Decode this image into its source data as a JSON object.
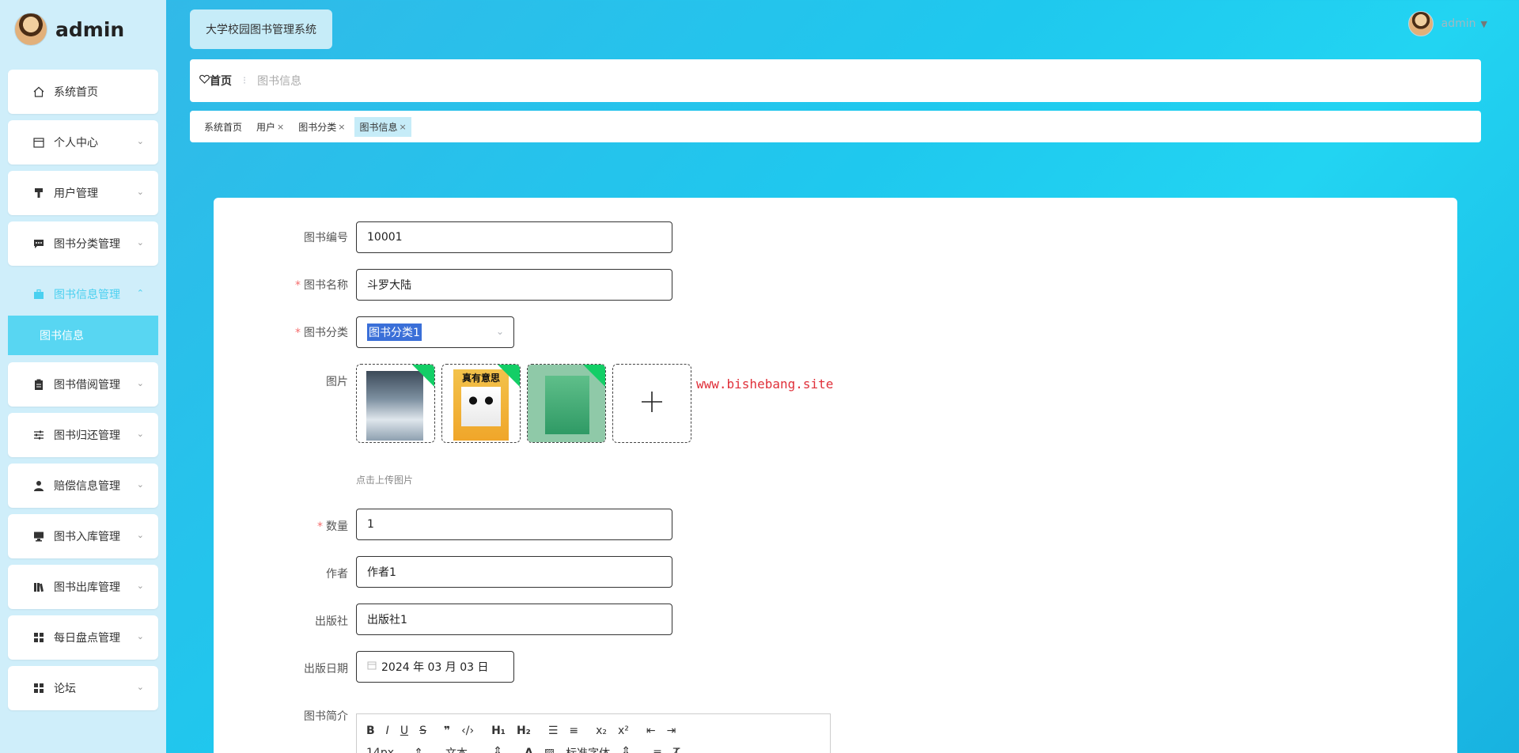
{
  "sidebar": {
    "brand": "admin",
    "items": [
      {
        "label": "系统首页"
      },
      {
        "label": "个人中心"
      },
      {
        "label": "用户管理"
      },
      {
        "label": "图书分类管理"
      },
      {
        "label": "图书信息管理"
      },
      {
        "label": "图书借阅管理"
      },
      {
        "label": "图书归还管理"
      },
      {
        "label": "赔偿信息管理"
      },
      {
        "label": "图书入库管理"
      },
      {
        "label": "图书出库管理"
      },
      {
        "label": "每日盘点管理"
      },
      {
        "label": "论坛"
      }
    ],
    "sub_item": "图书信息"
  },
  "header": {
    "app_title": "大学校园图书管理系统",
    "user_name": "admin"
  },
  "breadcrumb": {
    "home": "首页",
    "current": "图书信息"
  },
  "tabs": [
    {
      "label": "系统首页"
    },
    {
      "label": "用户"
    },
    {
      "label": "图书分类"
    },
    {
      "label": "图书信息"
    }
  ],
  "form": {
    "book_no_label": "图书编号",
    "book_no": "10001",
    "book_name_label": "图书名称",
    "book_name": "斗罗大陆",
    "category_label": "图书分类",
    "category": "图书分类1",
    "image_label": "图片",
    "cover2_text": "真有意思",
    "upload_hint": "点击上传图片",
    "watermark": "www.bishebang.site",
    "quantity_label": "数量",
    "quantity": "1",
    "author_label": "作者",
    "author": "作者1",
    "publisher_label": "出版社",
    "publisher": "出版社1",
    "pub_date_label": "出版日期",
    "pub_date": "2024 年 03 月 03 日",
    "intro_label": "图书简介",
    "editor": {
      "font_size": "14px",
      "text_style": "文本",
      "font_family": "标准字体"
    }
  }
}
